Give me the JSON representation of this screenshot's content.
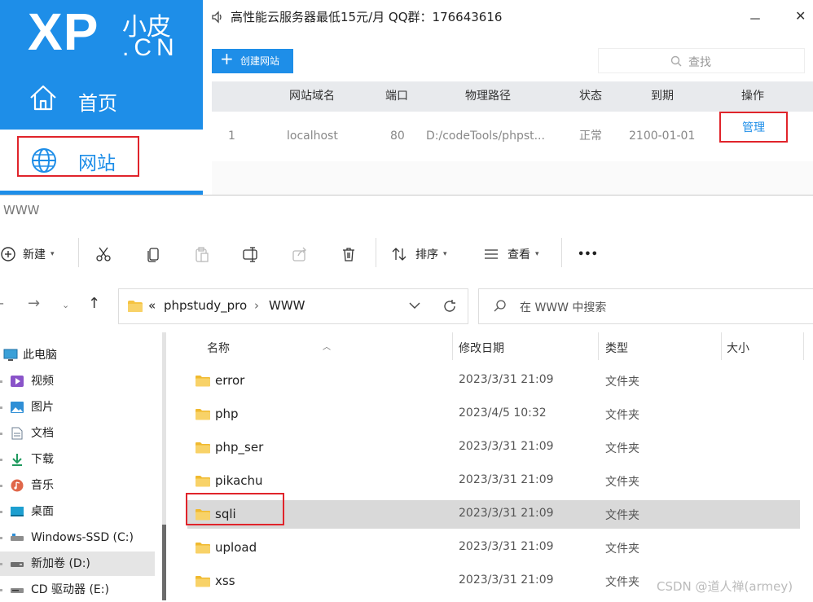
{
  "phpstudy": {
    "logo": {
      "xp": "XP",
      "small": "小皮",
      "cn": ".CN"
    },
    "sidebar": {
      "home_label": "首页",
      "site_label": "网站"
    },
    "announce": "高性能云服务器最低15元/月  QQ群：176643616",
    "window_controls": {
      "minimize": "－",
      "close": "✕"
    },
    "create_button": "创建网站",
    "search_placeholder": "查找",
    "table": {
      "headers": [
        "网站域名",
        "端口",
        "物理路径",
        "状态",
        "到期",
        "操作"
      ],
      "rows": [
        {
          "index": "1",
          "domain": "localhost",
          "port": "80",
          "path": "D:/codeTools/phpst...",
          "status": "正常",
          "expire": "2100-01-01",
          "action": "管理"
        }
      ]
    }
  },
  "explorer": {
    "title": "WWW",
    "toolbar": {
      "new": "新建",
      "sort": "排序",
      "view": "查看",
      "more": "•••"
    },
    "address": {
      "overflow": "«",
      "crumbs": [
        "phpstudy_pro",
        "WWW"
      ]
    },
    "search_placeholder": "在 WWW 中搜索",
    "nav": [
      {
        "label": "此电脑",
        "icon": "monitor-icon"
      },
      {
        "label": "视频",
        "icon": "video-icon"
      },
      {
        "label": "图片",
        "icon": "picture-icon"
      },
      {
        "label": "文档",
        "icon": "document-icon"
      },
      {
        "label": "下载",
        "icon": "download-icon"
      },
      {
        "label": "音乐",
        "icon": "music-icon"
      },
      {
        "label": "桌面",
        "icon": "desktop-icon"
      },
      {
        "label": "Windows-SSD (C:)",
        "icon": "drive-icon"
      },
      {
        "label": "新加卷 (D:)",
        "icon": "drive-icon"
      },
      {
        "label": "CD 驱动器 (E:)",
        "icon": "cd-drive-icon"
      }
    ],
    "columns": {
      "name": "名称",
      "date": "修改日期",
      "type": "类型",
      "size": "大小"
    },
    "files": [
      {
        "name": "error",
        "date": "2023/3/31 21:09",
        "type": "文件夹"
      },
      {
        "name": "php",
        "date": "2023/4/5 10:32",
        "type": "文件夹"
      },
      {
        "name": "php_ser",
        "date": "2023/3/31 21:09",
        "type": "文件夹"
      },
      {
        "name": "pikachu",
        "date": "2023/3/31 21:09",
        "type": "文件夹"
      },
      {
        "name": "sqli",
        "date": "2023/3/31 21:09",
        "type": "文件夹"
      },
      {
        "name": "upload",
        "date": "2023/3/31 21:09",
        "type": "文件夹"
      },
      {
        "name": "xss",
        "date": "2023/3/31 21:09",
        "type": "文件夹"
      }
    ]
  },
  "watermark": "CSDN @道人禅(armey)",
  "colors": {
    "brand_blue": "#1e8ee8",
    "highlight_red": "#e0242b",
    "selected_row": "#d9d9d9"
  }
}
